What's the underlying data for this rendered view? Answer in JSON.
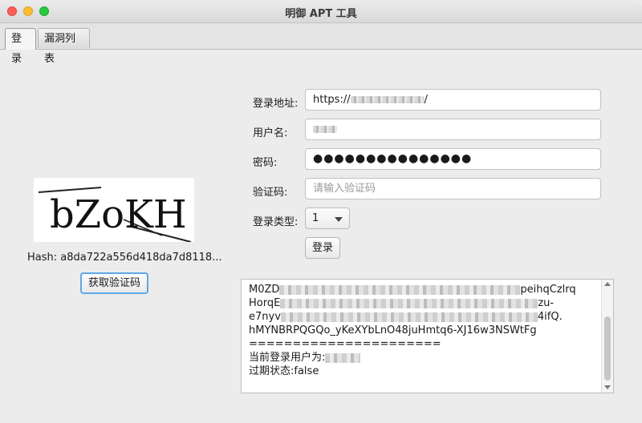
{
  "window": {
    "title": "明御 APT 工具"
  },
  "tabs": [
    {
      "label": "登录",
      "active": true
    },
    {
      "label": "漏洞列表",
      "active": false
    }
  ],
  "captcha": {
    "text": "bZoKH",
    "hash_label": "Hash: a8da722a556d418da7d8118...",
    "fetch_button": "获取验证码"
  },
  "form": {
    "address_label": "登录地址:",
    "address_value": "https://",
    "address_suffix": "/",
    "username_label": "用户名:",
    "password_label": "密码:",
    "password_value": "●●●●●●●●●●●●●●●",
    "captcha_label": "验证码:",
    "captcha_placeholder": "请输入验证码",
    "login_type_label": "登录类型:",
    "login_type_value": "1",
    "login_button": "登录"
  },
  "output": {
    "lines": [
      {
        "prefix": "M0ZD",
        "suffix": "peihqCzlrq"
      },
      {
        "prefix": "HorqE",
        "suffix": "zu-"
      },
      {
        "prefix": "e7nyv",
        "suffix": "4ifQ."
      },
      {
        "prefix": "hMYNBRPQGQo_yKeXYbLnO48juHmtq6-XJ16w3NSWtFg",
        "suffix": ""
      },
      {
        "prefix": "======================",
        "suffix": ""
      }
    ],
    "current_user_label": "当前登录用户为:",
    "expired_label": "过期状态:",
    "expired_value": "false"
  }
}
